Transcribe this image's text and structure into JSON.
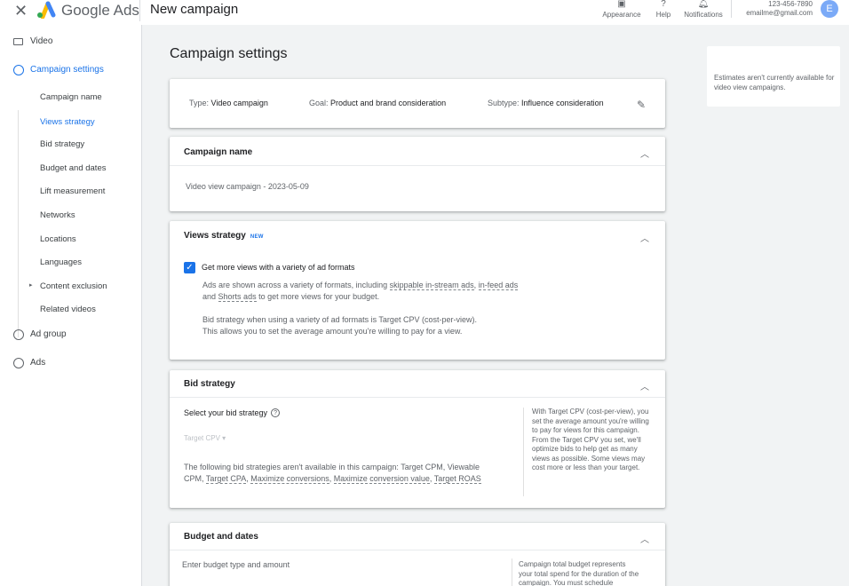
{
  "header": {
    "close_icon": "close-icon",
    "brand": "Google Ads",
    "title": "New campaign",
    "appearance_label": "Appearance",
    "help_label": "Help",
    "notifications_label": "Notifications",
    "customer_id": "123-456-7890",
    "email": "emailme@gmail.com",
    "avatar_letter": "E"
  },
  "sidebar": {
    "video": "Video",
    "campaign_settings": "Campaign settings",
    "sub_items": {
      "campaign_name": "Campaign name",
      "views_strategy": "Views strategy",
      "bid_strategy": "Bid strategy",
      "budget_dates": "Budget and dates",
      "lift_measurement": "Lift measurement",
      "networks": "Networks",
      "locations": "Locations",
      "languages": "Languages",
      "content_exclusion": "Content exclusion",
      "related_videos": "Related videos"
    },
    "ad_group": "Ad group",
    "ads": "Ads"
  },
  "main": {
    "title": "Campaign settings",
    "summary": {
      "type_label": "Type:",
      "type_value": "Video campaign",
      "goal_label": "Goal:",
      "goal_value": "Product and brand consideration",
      "subtype_label": "Subtype:",
      "subtype_value": "Influence consideration"
    },
    "campaign_name": {
      "header": "Campaign name",
      "value": "Video view campaign - 2023-05-09"
    },
    "views_strategy": {
      "header": "Views strategy",
      "badge": "NEW",
      "checkbox_label": "Get more views with a variety of ad formats",
      "desc_1a": "Ads are shown across a variety of formats, including",
      "desc_1_link1": "skippable in-stream ads",
      "desc_1b": ",",
      "desc_1_link2": "in-feed ads",
      "desc_1c": "and",
      "desc_1_link3": "Shorts ads",
      "desc_1d": "to get more views for your budget.",
      "desc_2a": "Bid strategy when using a variety of ad formats is Target CPV (cost-per-view).",
      "desc_2b": "This allows you to set the average amount you're willing to pay for a view."
    },
    "bid_strategy": {
      "header": "Bid strategy",
      "select_label": "Select your bid strategy",
      "select_value": "Target CPV",
      "unavailable_a": "The following bid strategies aren't available in this campaign: Target CPM, Viewable",
      "unavailable_b_pre": "CPM,",
      "link_target_cpa": "Target CPA",
      "link_max_conv": "Maximize conversions",
      "link_max_conv_value": "Maximize conversion value",
      "link_target_roas": "Target ROAS",
      "comma": ",",
      "note": "With Target CPV (cost-per-view), you set the average amount you're willing to pay for views for this campaign. From the Target CPV you set, we'll optimize bids to help get as many views as possible. Some views may cost more or less than your target."
    },
    "budget": {
      "header": "Budget and dates",
      "subtitle": "Enter budget type and amount",
      "note": "Campaign total budget represents your total spend for the duration of the campaign. You must schedule"
    }
  },
  "estimate_panel": {
    "text": "Estimates aren't currently available for video view campaigns."
  },
  "colors": {
    "accent": "#1a73e8",
    "background": "#f1f3f4"
  }
}
